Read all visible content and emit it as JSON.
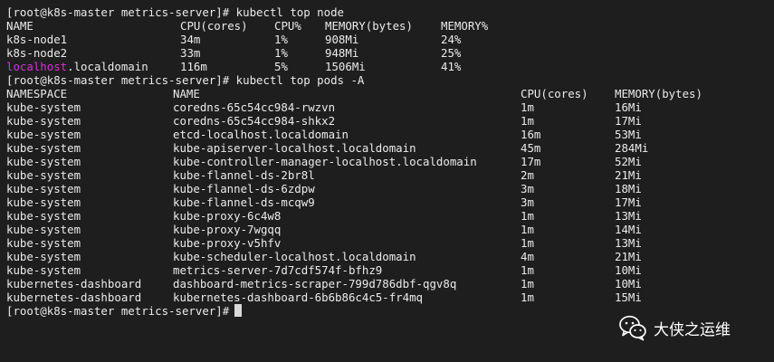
{
  "colors": {
    "background": "#1e1e1e",
    "text": "#ebebeb",
    "hostname_highlight": "#d335d3",
    "watermark": "#ffffff"
  },
  "lines": {
    "cmd1": {
      "prompt": "[root@k8s-master metrics-server]#",
      "command": "kubectl top node"
    },
    "cmd2": {
      "prompt": "[root@k8s-master metrics-server]#",
      "command": "kubectl top pods -A"
    },
    "cmd3": {
      "prompt": "[root@k8s-master metrics-server]#"
    }
  },
  "node_table": {
    "headers": [
      "NAME",
      "CPU(cores)",
      "CPU%",
      "MEMORY(bytes)",
      "MEMORY%"
    ],
    "rows": [
      {
        "name": "k8s-node1",
        "cpu": "34m",
        "cpu_pct": "1%",
        "mem": "908Mi",
        "mem_pct": "24%"
      },
      {
        "name": "k8s-node2",
        "cpu": "33m",
        "cpu_pct": "1%",
        "mem": "948Mi",
        "mem_pct": "25%"
      }
    ],
    "highlight_row": {
      "name_highlight": "localhost",
      "name_rest": ".localdomain",
      "cpu": "116m",
      "cpu_pct": "5%",
      "mem": "1506Mi",
      "mem_pct": "41%"
    }
  },
  "pods_table": {
    "headers": [
      "NAMESPACE",
      "NAME",
      "CPU(cores)",
      "MEMORY(bytes)"
    ],
    "rows": [
      [
        "kube-system",
        "coredns-65c54cc984-rwzvn",
        "1m",
        "16Mi"
      ],
      [
        "kube-system",
        "coredns-65c54cc984-shkx2",
        "1m",
        "17Mi"
      ],
      [
        "kube-system",
        "etcd-localhost.localdomain",
        "16m",
        "53Mi"
      ],
      [
        "kube-system",
        "kube-apiserver-localhost.localdomain",
        "45m",
        "284Mi"
      ],
      [
        "kube-system",
        "kube-controller-manager-localhost.localdomain",
        "17m",
        "52Mi"
      ],
      [
        "kube-system",
        "kube-flannel-ds-2br8l",
        "2m",
        "21Mi"
      ],
      [
        "kube-system",
        "kube-flannel-ds-6zdpw",
        "3m",
        "18Mi"
      ],
      [
        "kube-system",
        "kube-flannel-ds-mcqw9",
        "3m",
        "17Mi"
      ],
      [
        "kube-system",
        "kube-proxy-6c4w8",
        "1m",
        "13Mi"
      ],
      [
        "kube-system",
        "kube-proxy-7wgqq",
        "1m",
        "14Mi"
      ],
      [
        "kube-system",
        "kube-proxy-v5hfv",
        "1m",
        "13Mi"
      ],
      [
        "kube-system",
        "kube-scheduler-localhost.localdomain",
        "4m",
        "21Mi"
      ],
      [
        "kube-system",
        "metrics-server-7d7cdf574f-bfhz9",
        "1m",
        "10Mi"
      ],
      [
        "kubernetes-dashboard",
        "dashboard-metrics-scraper-799d786dbf-qgv8q",
        "1m",
        "10Mi"
      ],
      [
        "kubernetes-dashboard",
        "kubernetes-dashboard-6b6b86c4c5-fr4mq",
        "1m",
        "15Mi"
      ]
    ]
  },
  "watermark": {
    "icon": "wechat-icon",
    "text": "大侠之运维"
  }
}
